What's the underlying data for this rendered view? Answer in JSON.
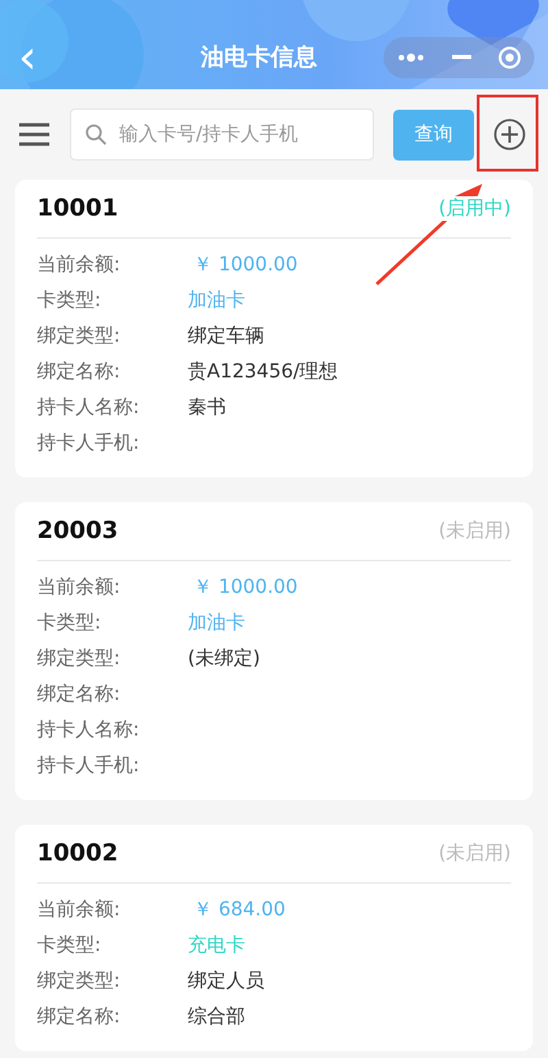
{
  "header": {
    "title": "油电卡信息",
    "back_icon": "‹"
  },
  "toolbar": {
    "search": {
      "placeholder": "输入卡号/持卡人手机"
    },
    "query_button": "查询"
  },
  "cards": [
    {
      "number": "10001",
      "status": "(启用中)",
      "active": true,
      "rows": [
        {
          "label": "当前余额:",
          "value": "￥ 1000.00",
          "kind": "amount"
        },
        {
          "label": "卡类型:",
          "value": "加油卡",
          "kind": "fuel"
        },
        {
          "label": "绑定类型:",
          "value": "绑定车辆",
          "kind": "plain"
        },
        {
          "label": "绑定名称:",
          "value": "贵A123456/理想",
          "kind": "plain"
        },
        {
          "label": "持卡人名称:",
          "value": "秦书",
          "kind": "plain"
        },
        {
          "label": "持卡人手机:"
        }
      ]
    },
    {
      "number": "20003",
      "status": "(未启用)",
      "active": false,
      "rows": [
        {
          "label": "当前余额:",
          "value": "￥ 1000.00",
          "kind": "amount"
        },
        {
          "label": "卡类型:",
          "value": "加油卡",
          "kind": "fuel"
        },
        {
          "label": "绑定类型:",
          "value": "(未绑定)",
          "kind": "plain"
        },
        {
          "label": "绑定名称:"
        },
        {
          "label": "持卡人名称:"
        },
        {
          "label": "持卡人手机:"
        }
      ]
    },
    {
      "number": "10002",
      "status": "(未启用)",
      "active": false,
      "rows": [
        {
          "label": "当前余额:",
          "value": "￥ 684.00",
          "kind": "amount"
        },
        {
          "label": "卡类型:",
          "value": "充电卡",
          "kind": "electric"
        },
        {
          "label": "绑定类型:",
          "value": "绑定人员",
          "kind": "plain"
        },
        {
          "label": "绑定名称:",
          "value": "综合部",
          "kind": "plain"
        }
      ]
    }
  ]
}
